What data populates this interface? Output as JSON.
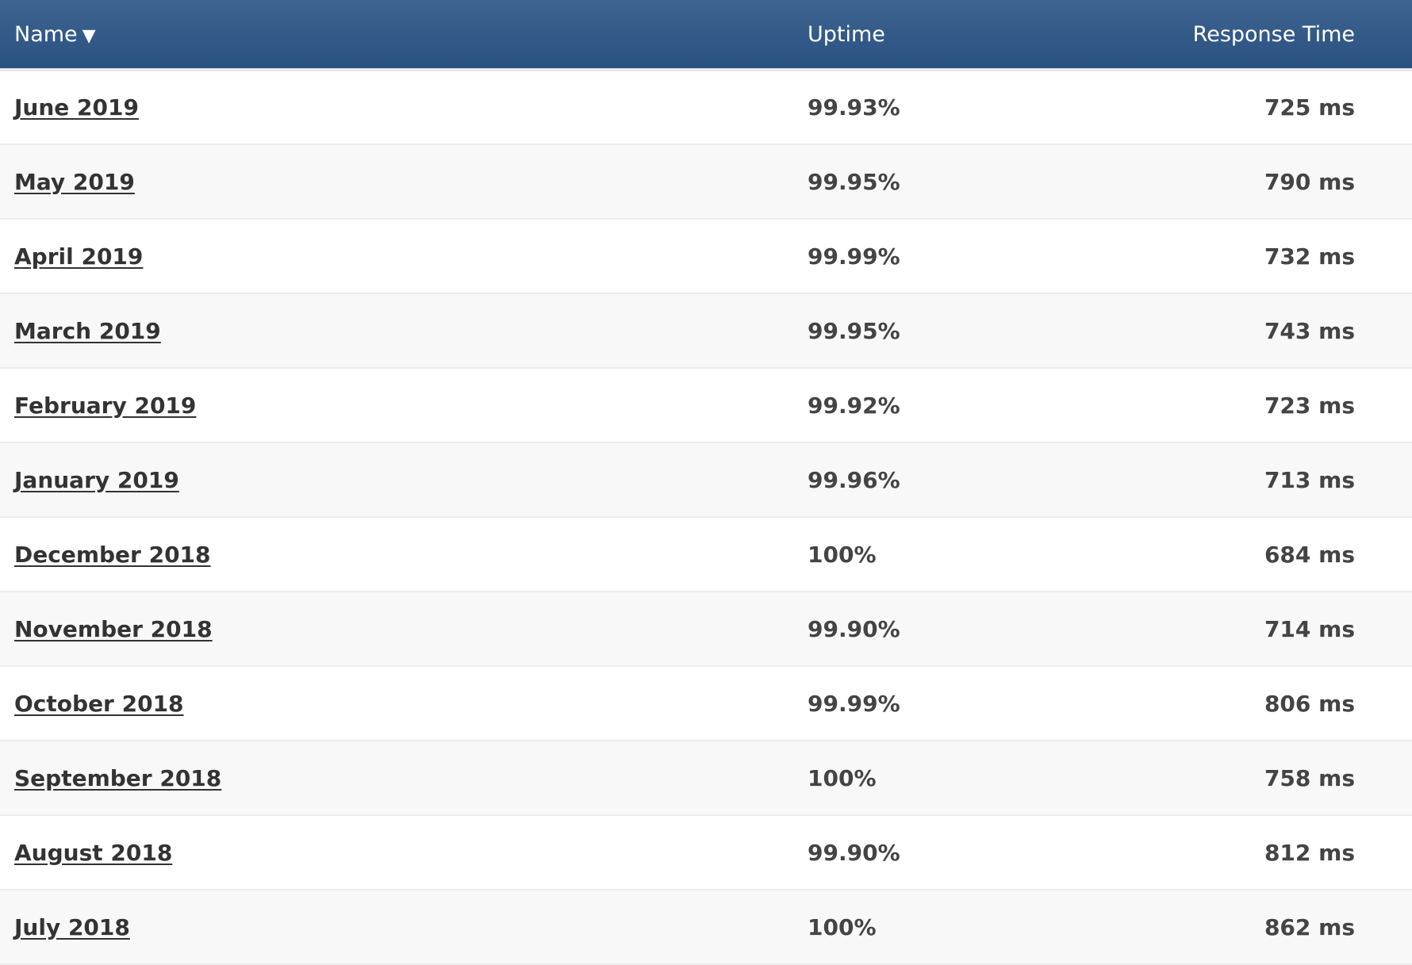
{
  "header": {
    "name": "Name",
    "sort_indicator": "▼",
    "uptime": "Uptime",
    "response_time": "Response Time"
  },
  "rows": [
    {
      "name": "June 2019",
      "uptime": "99.93%",
      "response": "725 ms"
    },
    {
      "name": "May 2019",
      "uptime": "99.95%",
      "response": "790 ms"
    },
    {
      "name": "April 2019",
      "uptime": "99.99%",
      "response": "732 ms"
    },
    {
      "name": "March 2019",
      "uptime": "99.95%",
      "response": "743 ms"
    },
    {
      "name": "February 2019",
      "uptime": "99.92%",
      "response": "723 ms"
    },
    {
      "name": "January 2019",
      "uptime": "99.96%",
      "response": "713 ms"
    },
    {
      "name": "December 2018",
      "uptime": "100%",
      "response": "684 ms"
    },
    {
      "name": "November 2018",
      "uptime": "99.90%",
      "response": "714 ms"
    },
    {
      "name": "October 2018",
      "uptime": "99.99%",
      "response": "806 ms"
    },
    {
      "name": "September 2018",
      "uptime": "100%",
      "response": "758 ms"
    },
    {
      "name": "August 2018",
      "uptime": "99.90%",
      "response": "812 ms"
    },
    {
      "name": "July 2018",
      "uptime": "100%",
      "response": "862 ms"
    }
  ],
  "colors": {
    "header_top": "#3e6591",
    "header_bottom": "#29507f",
    "row_alt": "#f8f8f8",
    "text": "#444444"
  }
}
